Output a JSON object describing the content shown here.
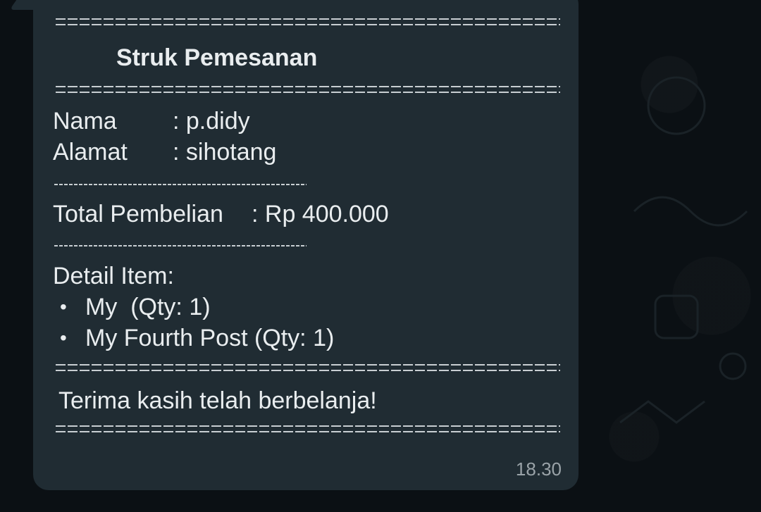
{
  "message": {
    "title": "Struk Pemesanan",
    "nama_label": "Nama",
    "nama_value": ": p.didy",
    "alamat_label": "Alamat",
    "alamat_value": ": sihotang",
    "total_label": "Total Pembelian",
    "total_value": ": Rp 400.000",
    "detail_heading": "Detail Item:",
    "items": [
      "My  (Qty: 1)",
      "My Fourth Post (Qty: 1)"
    ],
    "thanks": "Terima kasih telah berbelanja!",
    "timestamp": "18.30",
    "bullet": "•"
  },
  "colors": {
    "bubble": "#202c33",
    "text": "#e9edef",
    "timestamp": "#9aa3a8",
    "background": "#0b1014"
  }
}
